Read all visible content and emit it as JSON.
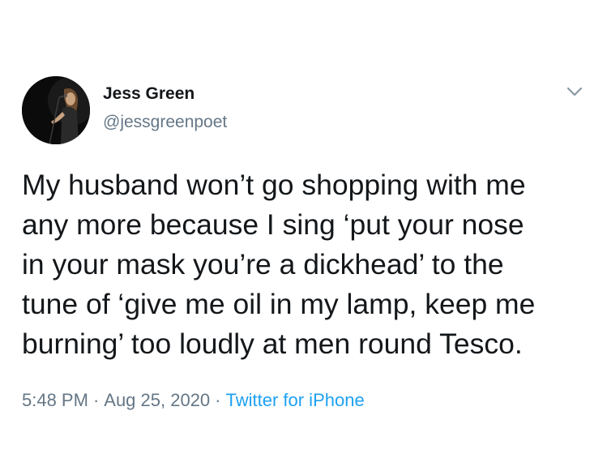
{
  "author": {
    "name": "Jess Green",
    "handle": "@jessgreenpoet"
  },
  "tweet": {
    "lines": [
      "My husband won’t go shopping with me",
      "any more because I sing ‘put your nose",
      "in your mask you’re a dickhead’ to the",
      "tune of ‘give me oil in my lamp, keep me",
      "burning’ too loudly at men round Tesco."
    ]
  },
  "meta": {
    "time": "5:48 PM",
    "date": "Aug 25, 2020",
    "separator": "·",
    "source": "Twitter for iPhone"
  },
  "icons": {
    "menu": "chevron-down-icon"
  },
  "colors": {
    "text": "#14171a",
    "secondary": "#657786",
    "link": "#1da1f2",
    "avatar_bg": "#0b0b0b"
  }
}
